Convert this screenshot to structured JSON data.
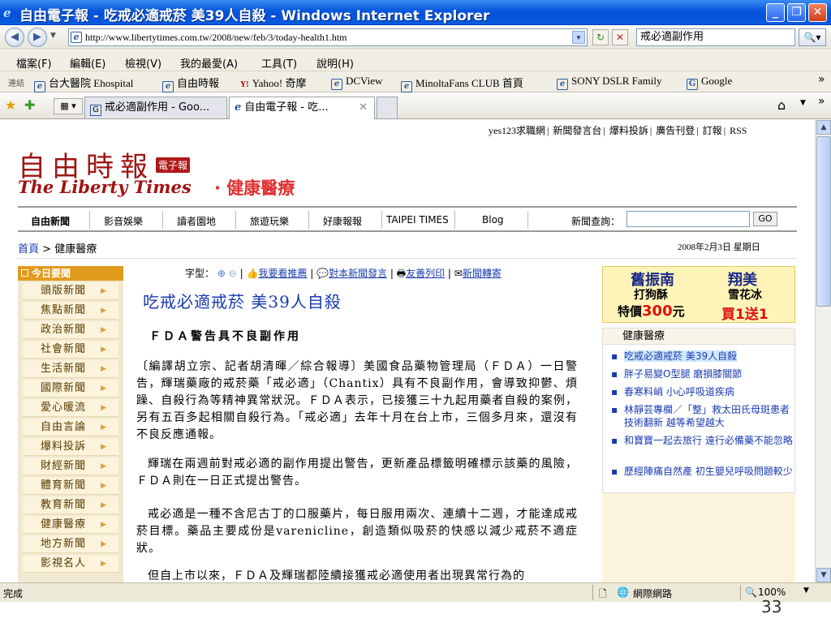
{
  "window": {
    "title": "自由電子報 - 吃戒必適戒菸 美39人自殺 - Windows Internet Explorer"
  },
  "address": {
    "url": "http://www.libertytimes.com.tw/2008/new/feb/3/today-health1.htm",
    "search_value": "戒必適副作用"
  },
  "menu": [
    "檔案(F)",
    "編輯(E)",
    "檢視(V)",
    "我的最愛(A)",
    "工具(T)",
    "說明(H)"
  ],
  "links_bar": {
    "label": "連結",
    "items": [
      "台大醫院 Ehospital",
      "自由時報",
      "Yahoo! 奇摩",
      "DCView",
      "MinoltaFans CLUB 首頁",
      "SONY DSLR Family",
      "Google"
    ]
  },
  "tabs": [
    {
      "label": "戒必適副作用 - Goo..."
    },
    {
      "label": "自由電子報 - 吃..."
    }
  ],
  "site": {
    "top_links": [
      "yes123求職網",
      "新聞發言台",
      "爆料投訴",
      "廣告刊登",
      "訂報",
      "RSS"
    ],
    "logo_cn": "自由時報",
    "logo_badge": "電子報",
    "logo_en": "The Liberty Times",
    "section": "· 健康醫療",
    "nav": [
      "自由新聞",
      "影音娛樂",
      "讀者園地",
      "旅遊玩樂",
      "好康報報",
      "TAIPEI TIMES",
      "Blog"
    ],
    "news_search_label": "新聞查詢：",
    "go": "GO",
    "breadcrumb_home": "首頁",
    "breadcrumb_sep": ">",
    "breadcrumb_current": "健康醫療",
    "date": "2008年2月3日 星期日"
  },
  "sidebar": {
    "head": "今日要聞",
    "items": [
      "頭版新聞",
      "焦點新聞",
      "政治新聞",
      "社會新聞",
      "生活新聞",
      "國際新聞",
      "愛心暖流",
      "自由言論",
      "爆料投訴",
      "財經新聞",
      "體育新聞",
      "教育新聞",
      "健康醫療",
      "地方新聞",
      "影視名人"
    ]
  },
  "article": {
    "tools": {
      "font_label": "字型：",
      "recommend": "我要看推薦",
      "comment": "對本新聞發言",
      "print": "友善列印",
      "forward": "新聞轉寄"
    },
    "headline": "吃戒必適戒菸 美39人自殺",
    "subhead": "ＦＤＡ警告具不良副作用",
    "paragraphs": [
      "〔編譯胡立宗、記者胡清暉／綜合報導〕美國食品藥物管理局（ＦＤＡ）一日警告，輝瑞藥廠的戒菸藥「戒必適」（Chantix）具有不良副作用，會導致抑鬱、煩躁、自殺行為等精神異常狀況。ＦＤＡ表示，已接獲三十九起用藥者自殺的案例，另有五百多起相關自殺行為。「戒必適」去年十月在台上市，三個多月來，還沒有不良反應通報。",
      "輝瑞在兩週前對戒必適的副作用提出警告，更新產品標籤明確標示該藥的風險，ＦＤＡ則在一日正式提出警告。",
      "戒必適是一種不含尼古丁的口服藥片，每日服用兩次、連續十二週，才能達成戒菸目標。藥品主要成份是varenicline，創造類似吸菸的快感以減少戒菸不適症狀。",
      "但自上市以來，ＦＤＡ及輝瑞都陸續接獲戒必適使用者出現異常行為的"
    ]
  },
  "ad": {
    "brand1": "舊振南",
    "item1": "打狗酥",
    "price_label": "特價",
    "price": "300",
    "price_unit": "元",
    "brand2": "翔美",
    "item2": "雪花冰",
    "promo": "買1送1"
  },
  "related": {
    "head": "健康醫療",
    "items": [
      "吃戒必適戒菸 美39人自殺",
      "胖子易變O型腿 磨損膝關節",
      "春寒料峭 小心呼吸道疾病",
      "林靜芸專欄／「整」救太田氏母斑患者 技術翻新 越等希望越大",
      "和寶寶一起去旅行 遠行必備藥不能忽略",
      "歷經陣痛自然產 初生嬰兒呼吸問題較少"
    ]
  },
  "status": {
    "left": "完成",
    "zone": "網際網路",
    "zoom": "100%"
  },
  "slide_number": "33"
}
